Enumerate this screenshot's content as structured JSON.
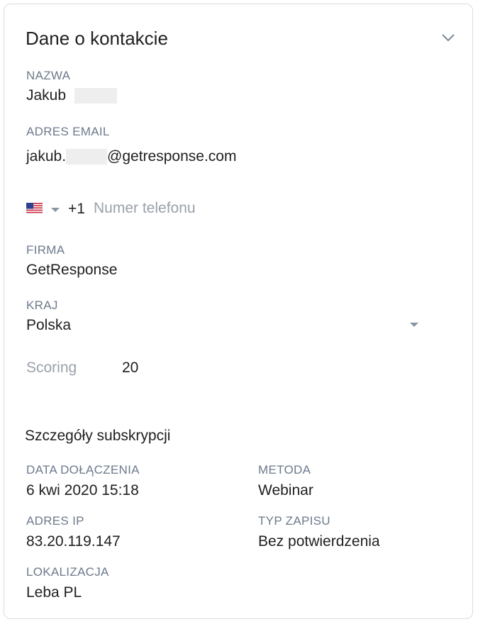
{
  "header": {
    "title": "Dane o kontakcie",
    "collapse_icon": "chevron-down-icon"
  },
  "contact": {
    "name_label": "NAZWA",
    "name_value": "Jakub",
    "email_label": "ADRES EMAIL",
    "email_prefix": "jakub.",
    "email_suffix": "@getresponse.com",
    "phone_country_icon": "us-flag-icon",
    "phone_code": "+1",
    "phone_placeholder": "Numer telefonu",
    "company_label": "FIRMA",
    "company_value": "GetResponse",
    "country_label": "KRAJ",
    "country_value": "Polska",
    "scoring_label": "Scoring",
    "scoring_value": "20"
  },
  "subscription": {
    "title": "Szczegóły subskrypcji",
    "join_date_label": "DATA DOŁĄCZENIA",
    "join_date_value": "6 kwi 2020 15:18",
    "method_label": "METODA",
    "method_value": "Webinar",
    "ip_label": "ADRES IP",
    "ip_value": "83.20.119.147",
    "optin_label": "TYP ZAPISU",
    "optin_value": "Bez potwierdzenia",
    "location_label": "LOKALIZACJA",
    "location_value": "Leba PL"
  }
}
